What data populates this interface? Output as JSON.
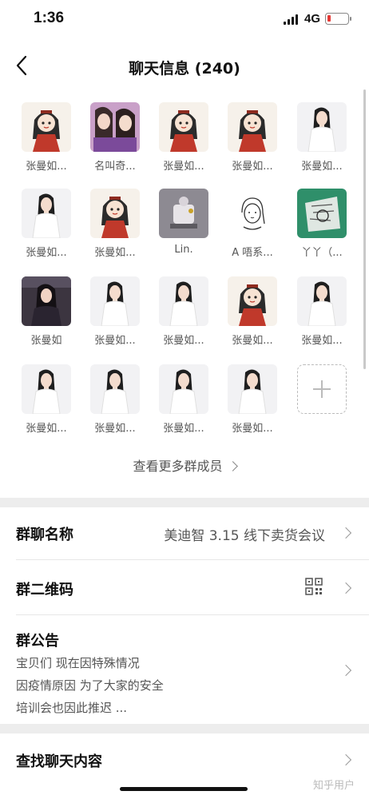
{
  "status_bar": {
    "time": "1:36",
    "network": "4G"
  },
  "nav": {
    "title": "聊天信息 (240)"
  },
  "members": [
    {
      "name": "张曼如...",
      "avatar": "cartoon-girl"
    },
    {
      "name": "名叫奇...",
      "avatar": "two-girls-photo"
    },
    {
      "name": "张曼如...",
      "avatar": "cartoon-girl"
    },
    {
      "name": "张曼如...",
      "avatar": "cartoon-girl"
    },
    {
      "name": "张曼如...",
      "avatar": "woman-white-dress"
    },
    {
      "name": "张曼如...",
      "avatar": "woman-white-dress"
    },
    {
      "name": "张曼如...",
      "avatar": "cartoon-girl"
    },
    {
      "name": "Lin.",
      "avatar": "figurine-photo"
    },
    {
      "name": "A 唔系...",
      "avatar": "line-drawing-girl"
    },
    {
      "name": "丫丫（...",
      "avatar": "green-sketch"
    },
    {
      "name": "张曼如",
      "avatar": "woman-dark-photo"
    },
    {
      "name": "张曼如...",
      "avatar": "woman-white-dress"
    },
    {
      "name": "张曼如...",
      "avatar": "woman-white-dress"
    },
    {
      "name": "张曼如...",
      "avatar": "cartoon-girl"
    },
    {
      "name": "张曼如...",
      "avatar": "woman-white-dress"
    },
    {
      "name": "张曼如...",
      "avatar": "woman-white-dress"
    },
    {
      "name": "张曼如...",
      "avatar": "woman-white-dress"
    },
    {
      "name": "张曼如...",
      "avatar": "woman-white-dress"
    },
    {
      "name": "张曼如...",
      "avatar": "woman-white-dress"
    }
  ],
  "more_members_label": "查看更多群成员",
  "group_name": {
    "label": "群聊名称",
    "value": "美迪智 3.15 线下卖货会议"
  },
  "qr_code": {
    "label": "群二维码"
  },
  "notice": {
    "label": "群公告",
    "lines": [
      "宝贝们 现在因特殊情况",
      "因疫情原因 为了大家的安全",
      "培训会也因此推迟 ..."
    ]
  },
  "search_history": {
    "label": "查找聊天内容"
  },
  "watermark": "知乎用户",
  "colors": {
    "separator": "#ededed",
    "text_secondary": "#555555",
    "battery_low": "#e53935"
  }
}
